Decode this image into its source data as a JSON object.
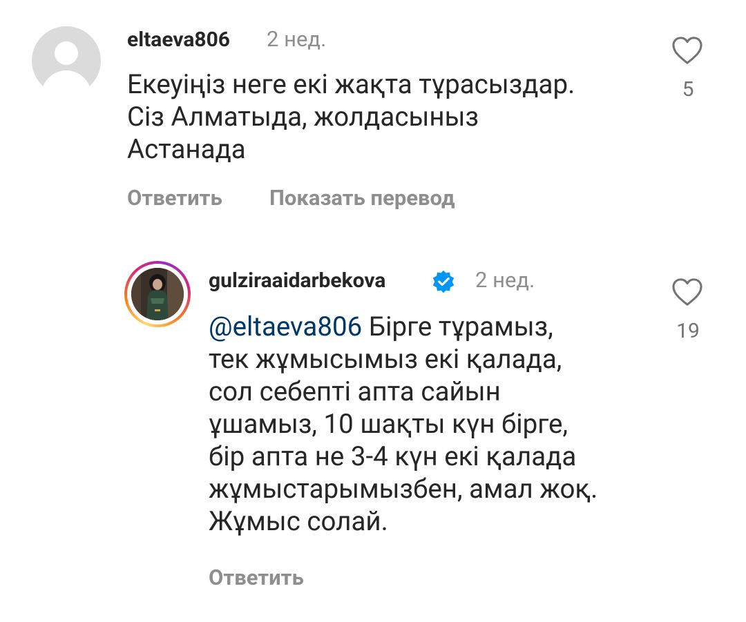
{
  "comments": [
    {
      "username": "eltaeva806",
      "time": "2 нед.",
      "text": "Екеуіңіз неге екі жақта тұрасыздар.\nСіз Алматыда, жолдасыныз\nАстанада",
      "likes": "5",
      "reply_label": "Ответить",
      "translate_label": "Показать перевод",
      "avatar": "default-avatar-icon"
    },
    {
      "username": "gulziraaidarbekova",
      "verified": true,
      "time": "2 нед.",
      "mention": "@eltaeva806",
      "text": "  Бірге тұрамыз,\nтек жұмысымыз екі қалада,\nсол себепті апта сайын\nұшамыз, 10 шақты күн бірге,\nбір апта не 3-4 күн екі қалада\nжұмыстарымызбен, амал жоқ.\nЖұмыс солай.",
      "likes": "19",
      "reply_label": "Ответить",
      "avatar": "user-photo-with-story-ring"
    }
  ],
  "colors": {
    "text": "#262626",
    "muted": "#8e8e8e",
    "mention": "#00376b",
    "verified": "#0095f6"
  }
}
